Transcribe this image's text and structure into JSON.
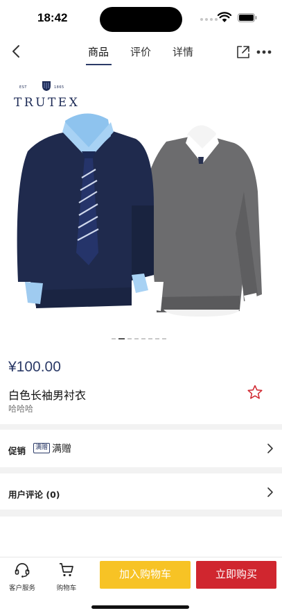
{
  "status_bar": {
    "time": "18:42"
  },
  "nav": {
    "tabs": [
      {
        "label": "商品",
        "active": true
      },
      {
        "label": "评价",
        "active": false
      },
      {
        "label": "详情",
        "active": false
      }
    ],
    "icons": [
      "back-icon",
      "share-icon",
      "more-icon"
    ]
  },
  "gallery": {
    "brand": {
      "name": "TRUTEX",
      "est": "EST",
      "year": "1865"
    },
    "image_count": 8,
    "current_image": 2
  },
  "product": {
    "price": "¥100.00",
    "title": "白色长袖男衬衣",
    "subtitle": "哈哈哈"
  },
  "promotion": {
    "label": "促销",
    "badge": "满赠",
    "text": "满赠"
  },
  "reviews": {
    "label": "用户评论 (0)"
  },
  "bottom_bar": {
    "service_label": "客户服务",
    "cart_label": "购物车",
    "add_to_cart": "加入购物车",
    "buy_now": "立即购买"
  },
  "colors": {
    "accent": "#2b3a67",
    "cart_button": "#f7c325",
    "buy_button": "#d0262f",
    "favorite": "#d0262f"
  }
}
